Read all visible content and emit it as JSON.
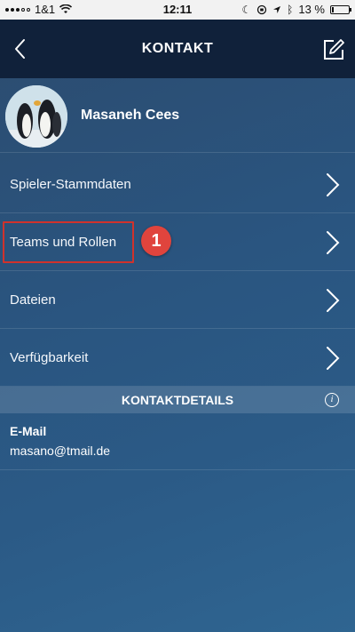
{
  "status_bar": {
    "carrier": "1&1",
    "time": "12:11",
    "battery_text": "13 %",
    "battery_level": 0.13,
    "icons": [
      "signal-icon",
      "wifi-icon",
      "moon-icon",
      "orientation-lock-icon",
      "location-icon",
      "bluetooth-icon",
      "battery-icon"
    ]
  },
  "nav": {
    "title": "KONTAKT",
    "back_icon": "chevron-left-icon",
    "edit_icon": "edit-icon"
  },
  "profile": {
    "name": "Masaneh Cees",
    "avatar": "penguins-avatar"
  },
  "menu": [
    {
      "label": "Spieler-Stammdaten"
    },
    {
      "label": "Teams und Rollen"
    },
    {
      "label": "Dateien"
    },
    {
      "label": "Verfügbarkeit"
    }
  ],
  "annotation": {
    "step_number": "1",
    "color": "#d0322c"
  },
  "details": {
    "header": "KONTAKTDETAILS",
    "info_icon": "i",
    "email_label": "E-Mail",
    "email_value": "masano@tmail.de"
  },
  "colors": {
    "nav_background": "#10213a",
    "background_gradient": [
      "#2c4b6e",
      "#2f6591"
    ],
    "highlight": "#d0322c",
    "badge": "#e0443d"
  }
}
